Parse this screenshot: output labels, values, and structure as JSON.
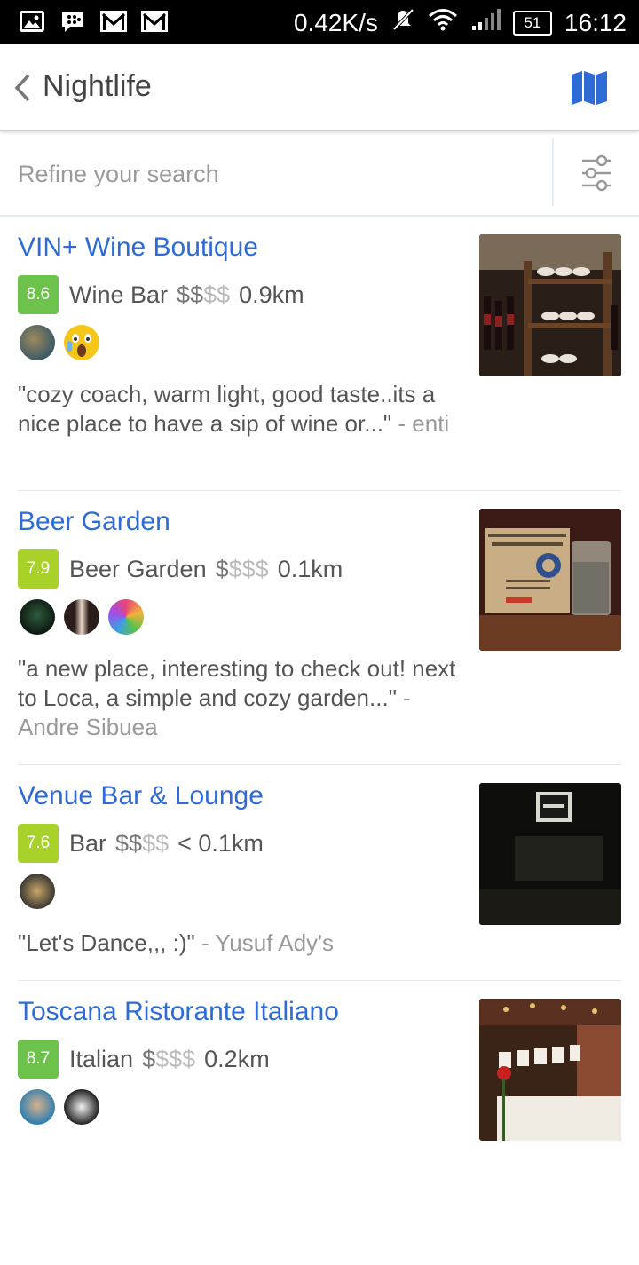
{
  "status": {
    "speed": "0.42K/s",
    "battery": "51",
    "time": "16:12",
    "left_icons": [
      "image-icon",
      "bbm-icon",
      "gmail-icon",
      "gmail-icon"
    ]
  },
  "appbar": {
    "title": "Nightlife",
    "back_icon": "chevron-left-icon",
    "map_icon": "map-icon"
  },
  "search": {
    "placeholder": "Refine your search",
    "filter_icon": "sliders-icon"
  },
  "colors": {
    "link": "#2e6bd6",
    "score_green": "#6cc24a",
    "score_lime": "#a8d12a"
  },
  "venues": [
    {
      "name": "VIN+ Wine Boutique",
      "score": "8.6",
      "category": "Wine Bar",
      "price_on": "$$",
      "price_off": "$$",
      "distance": "0.9km",
      "quote": "\"cozy coach, warm light, good taste..its a nice place to have a sip of wine or...\"",
      "author": "- enti"
    },
    {
      "name": "Beer Garden",
      "score": "7.9",
      "category": "Beer Garden",
      "price_on": "$",
      "price_off": "$$$",
      "distance": "0.1km",
      "quote": "\"a new place, interesting to check out! next to Loca, a simple and cozy garden...\"",
      "author": "- Andre Sibuea"
    },
    {
      "name": "Venue Bar & Lounge",
      "score": "7.6",
      "category": "Bar",
      "price_on": "$$",
      "price_off": "$$",
      "distance": "< 0.1km",
      "quote": "\"Let's Dance,,, :)\"",
      "author": "- Yusuf Ady's"
    },
    {
      "name": "Toscana Ristorante Italiano",
      "score": "8.7",
      "category": "Italian",
      "price_on": "$",
      "price_off": "$$$",
      "distance": "0.2km",
      "quote": "",
      "author": ""
    }
  ]
}
